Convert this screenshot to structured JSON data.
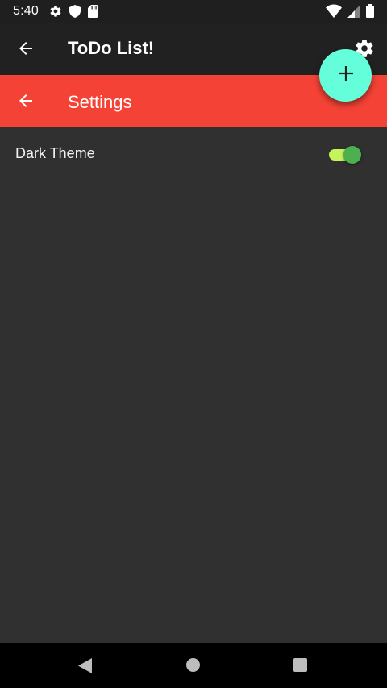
{
  "status_bar": {
    "time": "5:40",
    "left_icons": [
      "settings-gear-icon",
      "shield-icon",
      "sd-card-icon"
    ],
    "right_icons": [
      "wifi-icon",
      "cell-signal-icon",
      "battery-icon"
    ]
  },
  "app_bar": {
    "title": "ToDo List!",
    "back_icon": "arrow-back-icon",
    "action_icon": "gear-icon",
    "background": "#212121"
  },
  "settings_bar": {
    "title": "Settings",
    "back_icon": "arrow-back-icon",
    "background": "#f44336"
  },
  "fab": {
    "icon": "plus-icon",
    "background": "#64ffda"
  },
  "settings": {
    "items": [
      {
        "label": "Dark Theme",
        "checked": true,
        "track_color": "#c6f25c",
        "thumb_color": "#4caf50"
      }
    ]
  },
  "nav_bar": {
    "buttons": [
      "back-triangle-icon",
      "home-circle-icon",
      "recents-square-icon"
    ]
  }
}
